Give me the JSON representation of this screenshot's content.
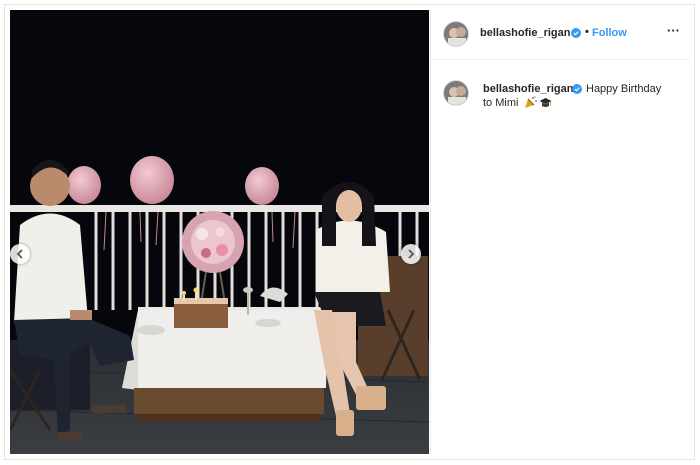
{
  "post": {
    "author": "bellashofie_rigan",
    "separator": "•",
    "follow_label": "Follow",
    "more_label": "···",
    "verified": true,
    "icons": {
      "verified": "verified-badge-icon",
      "more": "more-options-icon",
      "prev": "chevron-left-icon",
      "next": "chevron-right-icon",
      "emoji_1": "party-popper-emoji",
      "emoji_2": "graduation-cap-emoji"
    }
  },
  "caption": {
    "author": "bellashofie_rigan",
    "line1": "Happy Birthday",
    "line2": "to Mimi"
  },
  "colors": {
    "follow": "#3897f0",
    "verified": "#3897f0",
    "photo_background": "#07080d"
  }
}
